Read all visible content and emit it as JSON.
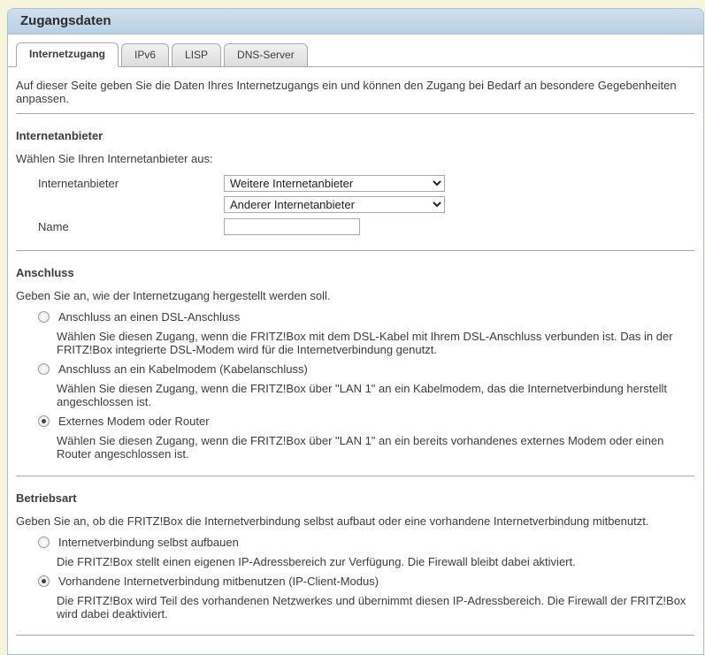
{
  "title": "Zugangsdaten",
  "tabs": [
    {
      "label": "Internetzugang",
      "active": true
    },
    {
      "label": "IPv6",
      "active": false
    },
    {
      "label": "LISP",
      "active": false
    },
    {
      "label": "DNS-Server",
      "active": false
    }
  ],
  "intro": "Auf dieser Seite geben Sie die Daten Ihres Internetzugangs ein und können den Zugang bei Bedarf an besondere Gegebenheiten anpassen.",
  "provider": {
    "heading": "Internetanbieter",
    "prompt": "Wählen Sie Ihren Internetanbieter aus:",
    "provider_label": "Internetanbieter",
    "select1_value": "Weitere Internetanbieter",
    "select2_value": "Anderer Internetanbieter",
    "name_label": "Name",
    "name_value": ""
  },
  "connection": {
    "heading": "Anschluss",
    "prompt": "Geben Sie an, wie der Internetzugang hergestellt werden soll.",
    "options": [
      {
        "label": "Anschluss an einen DSL-Anschluss",
        "desc": "Wählen Sie diesen Zugang, wenn die FRITZ!Box mit dem DSL-Kabel mit Ihrem DSL-Anschluss verbunden ist. Das in der FRITZ!Box integrierte DSL-Modem wird für die Internetverbindung genutzt.",
        "checked": false
      },
      {
        "label": "Anschluss an ein Kabelmodem (Kabelanschluss)",
        "desc": "Wählen Sie diesen Zugang, wenn die FRITZ!Box über \"LAN 1\" an ein Kabelmodem, das die Internetverbindung herstellt angeschlossen ist.",
        "checked": false
      },
      {
        "label": "Externes Modem oder Router",
        "desc": "Wählen Sie diesen Zugang, wenn die FRITZ!Box über \"LAN 1\" an ein bereits vorhandenes externes Modem oder einen Router angeschlossen ist.",
        "checked": true
      }
    ]
  },
  "mode": {
    "heading": "Betriebsart",
    "prompt": "Geben Sie an, ob die FRITZ!Box die Internetverbindung selbst aufbaut oder eine vorhandene Internetverbindung mitbenutzt.",
    "options": [
      {
        "label": "Internetverbindung selbst aufbauen",
        "desc": "Die FRITZ!Box stellt einen eigenen IP-Adressbereich zur Verfügung. Die Firewall bleibt dabei aktiviert.",
        "checked": false
      },
      {
        "label": "Vorhandene Internetverbindung mitbenutzen (IP-Client-Modus)",
        "desc": "Die FRITZ!Box wird Teil des vorhandenen Netzwerkes und übernimmt diesen IP-Adressbereich. Die Firewall der FRITZ!Box wird dabei deaktiviert.",
        "checked": true
      }
    ]
  }
}
